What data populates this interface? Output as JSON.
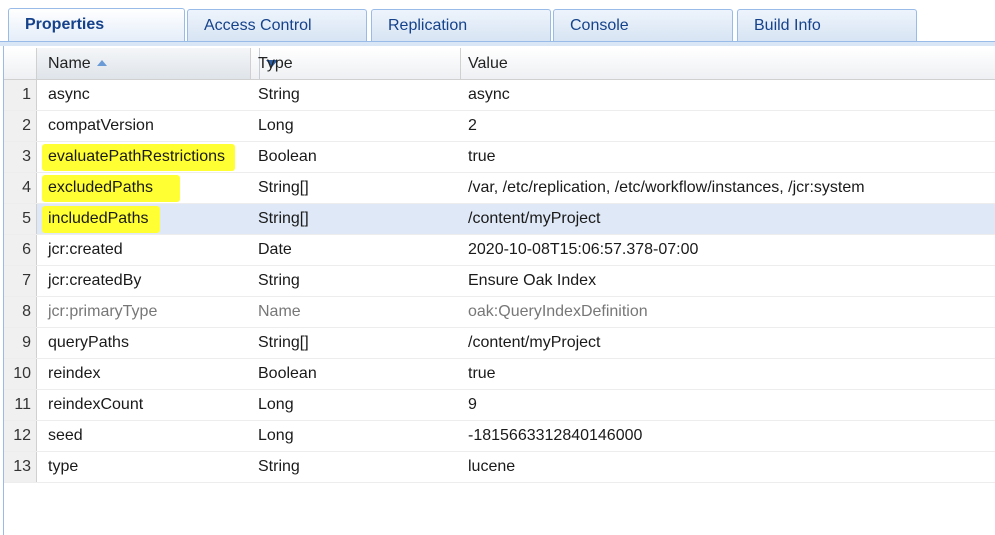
{
  "tabs": [
    {
      "label": "Properties",
      "active": true
    },
    {
      "label": "Access Control",
      "active": false
    },
    {
      "label": "Replication",
      "active": false
    },
    {
      "label": "Console",
      "active": false
    },
    {
      "label": "Build Info",
      "active": false
    }
  ],
  "columns": {
    "name": "Name",
    "type": "Type",
    "value": "Value"
  },
  "rows": [
    {
      "num": "1",
      "name": "async",
      "type": "String",
      "value": "async"
    },
    {
      "num": "2",
      "name": "compatVersion",
      "type": "Long",
      "value": "2"
    },
    {
      "num": "3",
      "name": "evaluatePathRestrictions",
      "type": "Boolean",
      "value": "true",
      "highlight": true
    },
    {
      "num": "4",
      "name": "excludedPaths",
      "type": "String[]",
      "value": "/var, /etc/replication, /etc/workflow/instances, /jcr:system",
      "highlight": true
    },
    {
      "num": "5",
      "name": "includedPaths",
      "type": "String[]",
      "value": "/content/myProject",
      "highlight": true,
      "selected": true
    },
    {
      "num": "6",
      "name": "jcr:created",
      "type": "Date",
      "value": "2020-10-08T15:06:57.378-07:00"
    },
    {
      "num": "7",
      "name": "jcr:createdBy",
      "type": "String",
      "value": "Ensure Oak Index"
    },
    {
      "num": "8",
      "name": "jcr:primaryType",
      "type": "Name",
      "value": "oak:QueryIndexDefinition",
      "muted": true
    },
    {
      "num": "9",
      "name": "queryPaths",
      "type": "String[]",
      "value": "/content/myProject"
    },
    {
      "num": "10",
      "name": "reindex",
      "type": "Boolean",
      "value": "true"
    },
    {
      "num": "11",
      "name": "reindexCount",
      "type": "Long",
      "value": "9"
    },
    {
      "num": "12",
      "name": "seed",
      "type": "Long",
      "value": "-1815663312840146000"
    },
    {
      "num": "13",
      "name": "type",
      "type": "String",
      "value": "lucene"
    }
  ],
  "colors": {
    "highlight": "#ffff33",
    "selected_row": "#dfe8f6",
    "tab_text": "#15428b"
  },
  "icons": [
    "sort-ascending-icon",
    "column-menu-icon"
  ]
}
